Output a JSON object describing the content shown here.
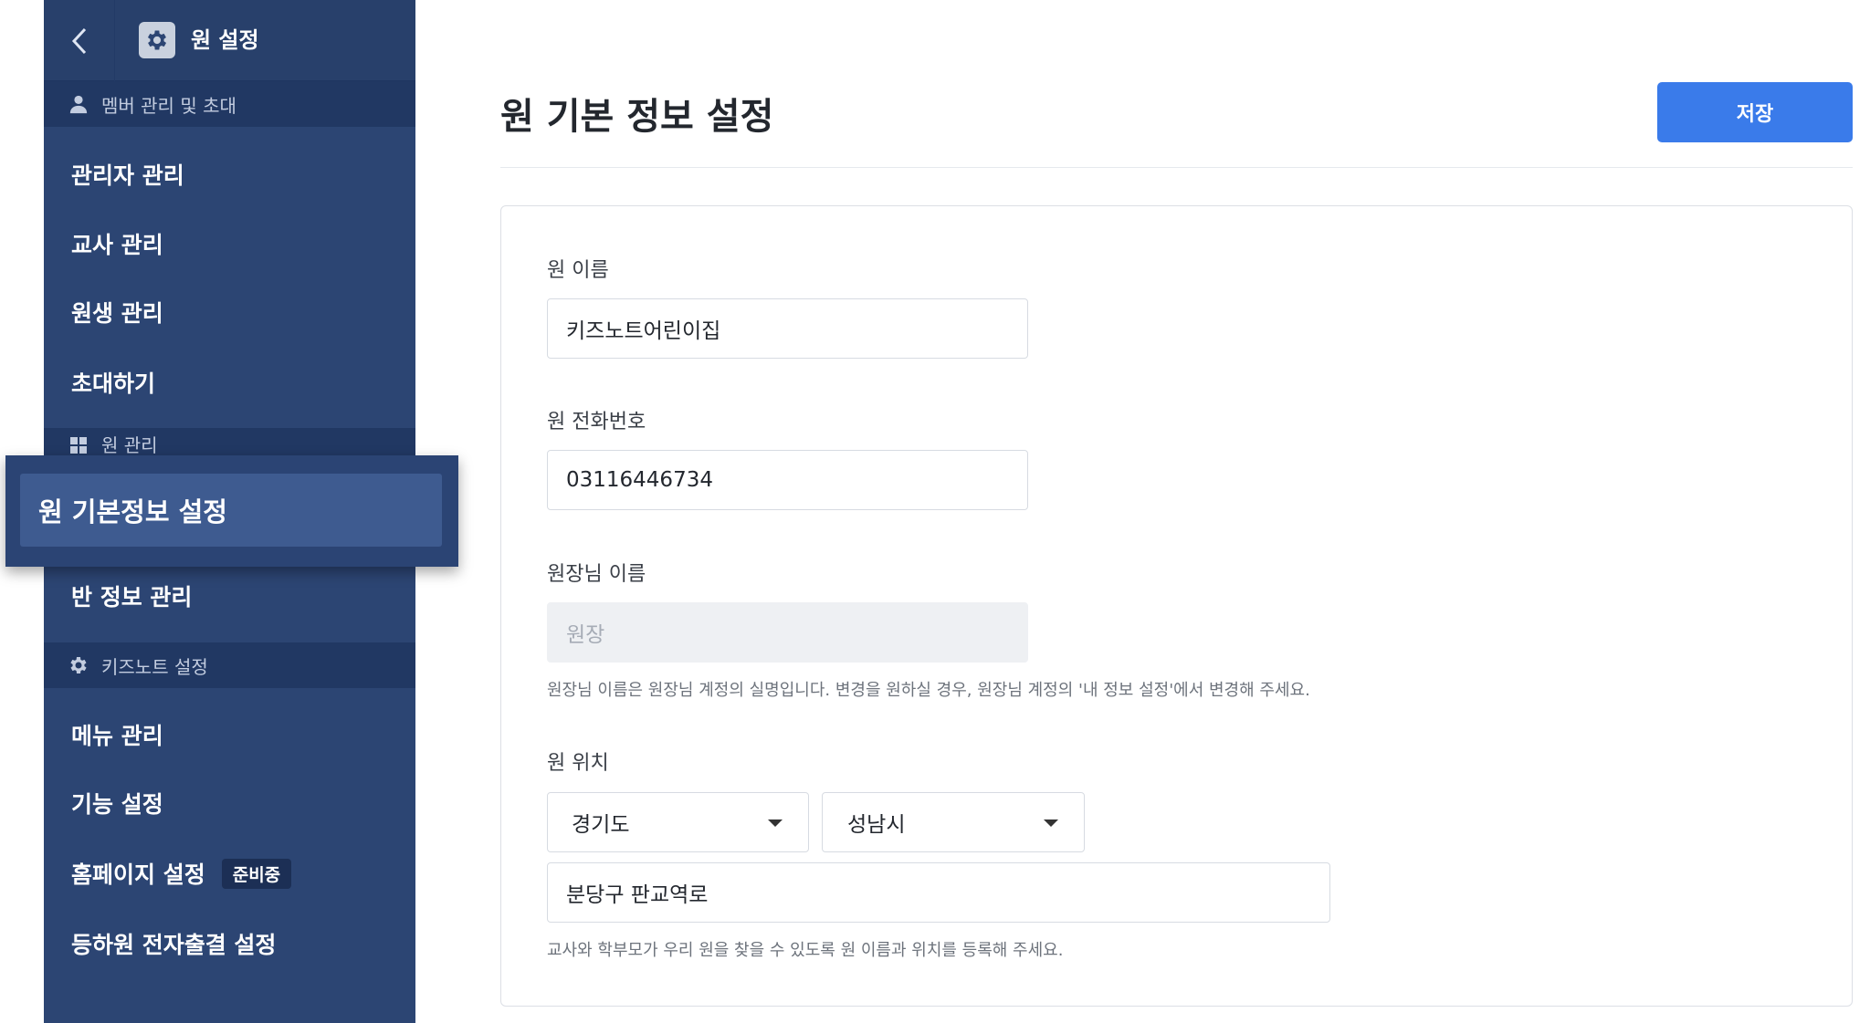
{
  "sidebar": {
    "header": {
      "back_icon": "chevron-left-icon",
      "gear_icon": "gear-icon",
      "title": "원 설정"
    },
    "sections": [
      {
        "icon": "person-icon",
        "label": "멤버 관리 및 초대",
        "items": [
          "관리자 관리",
          "교사 관리",
          "원생 관리",
          "초대하기"
        ]
      },
      {
        "icon": "grid-icon",
        "label": "원 관리",
        "items": [
          "원 기본정보 설정",
          "반 정보 관리"
        ]
      },
      {
        "icon": "gear-icon",
        "label": "키즈노트 설정",
        "items": [
          "메뉴 관리",
          "기능 설정",
          "홈페이지 설정",
          "등하원 전자출결 설정"
        ]
      }
    ],
    "homepage_badge": "준비중",
    "active_item": "원 기본정보 설정"
  },
  "main": {
    "title": "원 기본 정보 설정",
    "save_label": "저장",
    "colors": {
      "accent": "#3a7bea",
      "sidebar": "#2c4573"
    },
    "form": {
      "name": {
        "label": "원 이름",
        "value": "키즈노트어린이집"
      },
      "phone": {
        "label": "원 전화번호",
        "value": "03116446734"
      },
      "director": {
        "label": "원장님 이름",
        "placeholder": "원장",
        "help": "원장님 이름은 원장님 계정의 실명입니다. 변경을 원하실 경우, 원장님 계정의 '내 정보 설정'에서 변경해 주세요."
      },
      "location": {
        "label": "원 위치",
        "province": "경기도",
        "city": "성남시",
        "address": "분당구 판교역로",
        "help": "교사와 학부모가 우리 원을 찾을 수 있도록 원 이름과 위치를 등록해 주세요."
      }
    }
  }
}
